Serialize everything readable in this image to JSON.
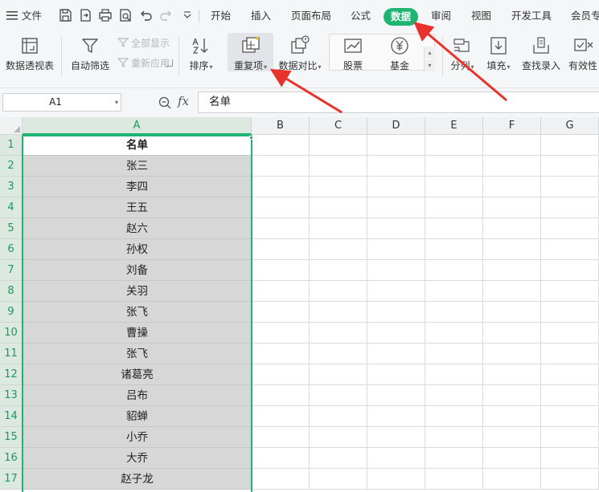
{
  "menubar": {
    "file_label": "文件",
    "tabs": [
      {
        "label": "开始"
      },
      {
        "label": "插入"
      },
      {
        "label": "页面布局"
      },
      {
        "label": "公式"
      },
      {
        "label": "数据"
      },
      {
        "label": "审阅"
      },
      {
        "label": "视图"
      },
      {
        "label": "开发工具"
      },
      {
        "label": "会员专"
      }
    ],
    "active_tab": "数据",
    "quick_access_icons": [
      "save-icon",
      "export-icon",
      "print-icon",
      "print-preview-icon",
      "undo-icon",
      "redo-icon",
      "more-icon"
    ]
  },
  "ribbon": {
    "pivot_table": "数据透视表",
    "auto_filter": "自动筛选",
    "show_all": "全部显示",
    "reapply": "重新应用",
    "sort": "排序",
    "duplicates": "重复项",
    "data_compare": "数据对比",
    "stock": "股票",
    "fund": "基金",
    "split": "分列",
    "fill": "填充",
    "lookup_entry": "查找录入",
    "validity": "有效性"
  },
  "formula_bar": {
    "name_box": "A1",
    "fx_label": "fx",
    "content": "名单"
  },
  "grid": {
    "columns": [
      "A",
      "B",
      "C",
      "D",
      "E",
      "F",
      "G"
    ],
    "selected_column": "A",
    "rows": [
      {
        "num": "1",
        "a": "名单"
      },
      {
        "num": "2",
        "a": "张三"
      },
      {
        "num": "3",
        "a": "李四"
      },
      {
        "num": "4",
        "a": "王五"
      },
      {
        "num": "5",
        "a": "赵六"
      },
      {
        "num": "6",
        "a": "孙权"
      },
      {
        "num": "7",
        "a": "刘备"
      },
      {
        "num": "8",
        "a": "关羽"
      },
      {
        "num": "9",
        "a": "张飞"
      },
      {
        "num": "10",
        "a": "曹操"
      },
      {
        "num": "11",
        "a": "张飞"
      },
      {
        "num": "12",
        "a": "诸葛亮"
      },
      {
        "num": "13",
        "a": "吕布"
      },
      {
        "num": "14",
        "a": "貂蝉"
      },
      {
        "num": "15",
        "a": "小乔"
      },
      {
        "num": "16",
        "a": "大乔"
      },
      {
        "num": "17",
        "a": "赵子龙"
      }
    ]
  },
  "colors": {
    "accent": "#1fb471",
    "annotation": "#e8322c",
    "selection_fill": "#d7d7d7"
  }
}
